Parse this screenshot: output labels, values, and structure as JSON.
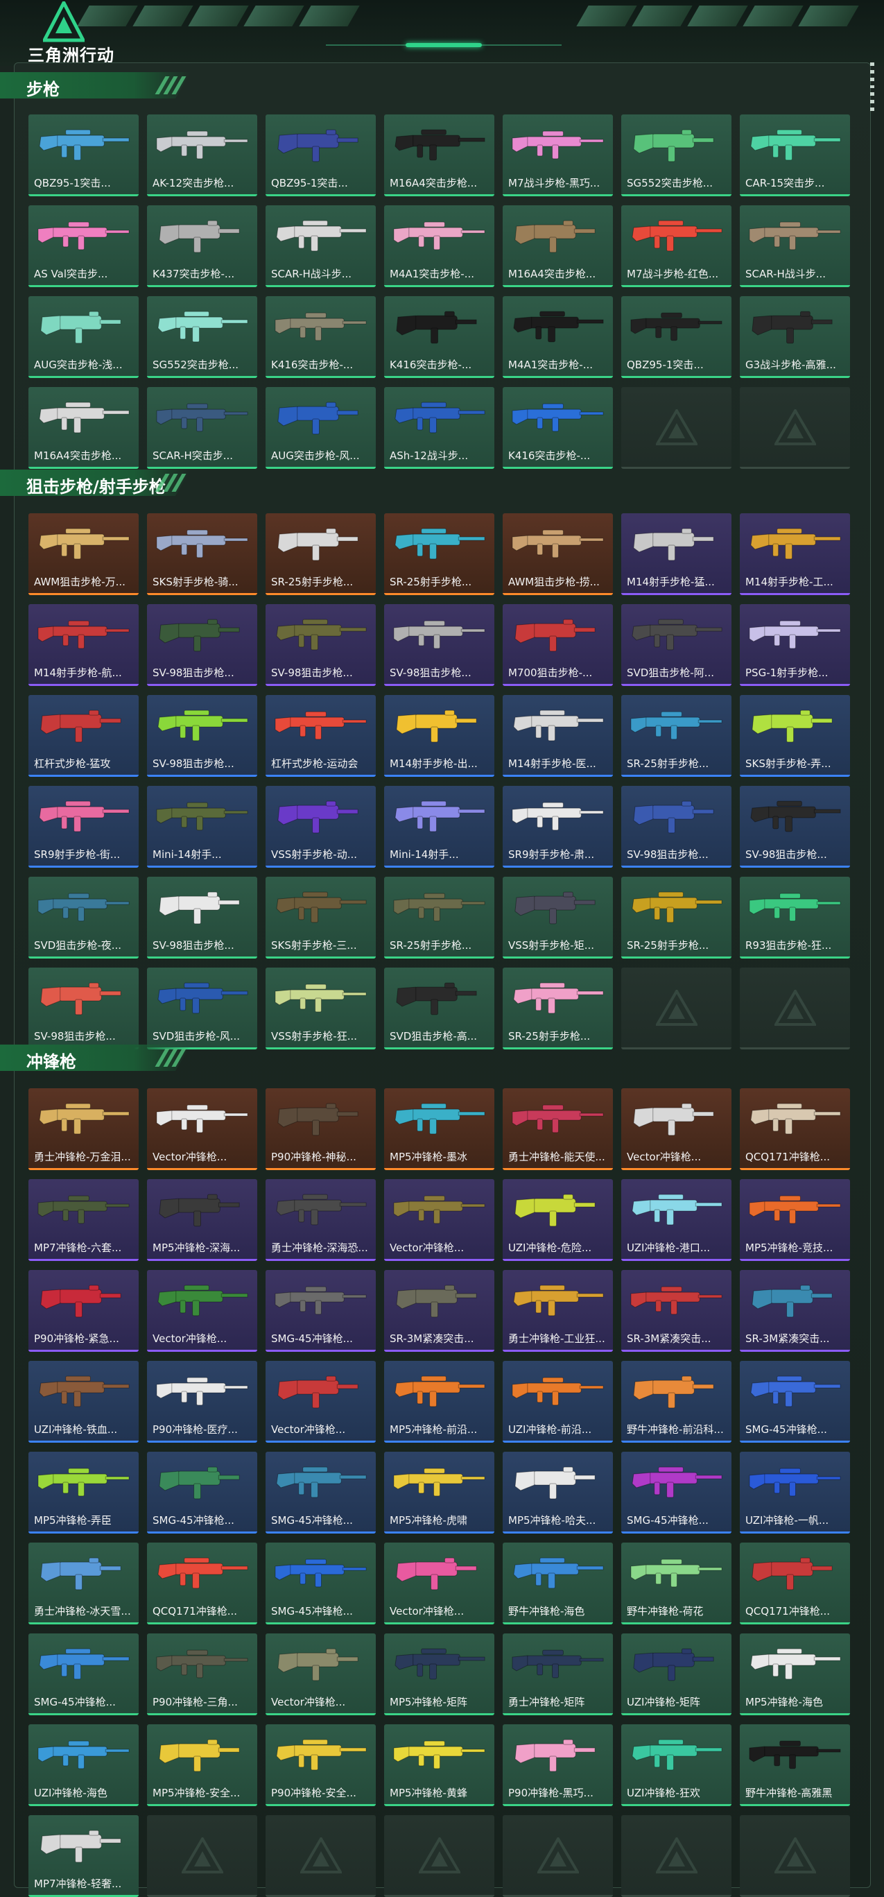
{
  "logo": {
    "text": "三角洲行动",
    "icon": "delta-triangle-logo-icon"
  },
  "colors": {
    "green": "#3ad487",
    "orange": "#ff8a2a",
    "purple": "#8b5cf6",
    "blue": "#3b82f6"
  },
  "sections": [
    {
      "title": "步枪",
      "items": [
        {
          "name": "QBZ95-1突击...",
          "rarity": "green",
          "color": "#4aa3d8"
        },
        {
          "name": "AK-12突击步枪...",
          "rarity": "green",
          "color": "#c9ccd0"
        },
        {
          "name": "QBZ95-1突击...",
          "rarity": "green",
          "color": "#3a4aa0"
        },
        {
          "name": "M16A4突击步枪...",
          "rarity": "green",
          "color": "#222222"
        },
        {
          "name": "M7战斗步枪-黑巧...",
          "rarity": "green",
          "color": "#e88ad0"
        },
        {
          "name": "SG552突击步枪...",
          "rarity": "green",
          "color": "#58c27a"
        },
        {
          "name": "CAR-15突击步...",
          "rarity": "green",
          "color": "#4ed3a3"
        },
        {
          "name": "AS Val突击步...",
          "rarity": "green",
          "color": "#ef7fc0"
        },
        {
          "name": "K437突击步枪-...",
          "rarity": "green",
          "color": "#b0b0b0"
        },
        {
          "name": "SCAR-H战斗步...",
          "rarity": "green",
          "color": "#d8d8d8"
        },
        {
          "name": "M4A1突击步枪-...",
          "rarity": "green",
          "color": "#eaa6c6"
        },
        {
          "name": "M16A4突击步枪...",
          "rarity": "green",
          "color": "#9a7e58"
        },
        {
          "name": "M7战斗步枪-红色...",
          "rarity": "green",
          "color": "#e84a3a"
        },
        {
          "name": "SCAR-H战斗步...",
          "rarity": "green",
          "color": "#a08a70"
        },
        {
          "name": "AUG突击步枪-浅...",
          "rarity": "green",
          "color": "#7fd8c0"
        },
        {
          "name": "SG552突击步枪...",
          "rarity": "green",
          "color": "#8fe0d0"
        },
        {
          "name": "K416突击步枪-...",
          "rarity": "green",
          "color": "#8a8670"
        },
        {
          "name": "K416突击步枪-...",
          "rarity": "green",
          "color": "#1c1c1c"
        },
        {
          "name": "M4A1突击步枪-...",
          "rarity": "green",
          "color": "#1c1c1c"
        },
        {
          "name": "QBZ95-1突击...",
          "rarity": "green",
          "color": "#222222"
        },
        {
          "name": "G3战斗步枪-高雅...",
          "rarity": "green",
          "color": "#2a2a2a"
        },
        {
          "name": "M16A4突击步枪...",
          "rarity": "green",
          "color": "#d8d8d8"
        },
        {
          "name": "SCAR-H突击步...",
          "rarity": "green",
          "color": "#3a5a80"
        },
        {
          "name": "AUG突击步枪-风...",
          "rarity": "green",
          "color": "#2a5fbf"
        },
        {
          "name": "ASh-12战斗步...",
          "rarity": "green",
          "color": "#2a5fbf"
        },
        {
          "name": "K416突击步枪-...",
          "rarity": "green",
          "color": "#2a6fd8"
        },
        {
          "name": "",
          "rarity": "empty"
        },
        {
          "name": "",
          "rarity": "empty"
        }
      ]
    },
    {
      "title": "狙击步枪/射手步枪",
      "items": [
        {
          "name": "AWM狙击步枪-万...",
          "rarity": "orange",
          "color": "#d9b36a"
        },
        {
          "name": "SKS射手步枪-骑...",
          "rarity": "orange",
          "color": "#9aa8c8"
        },
        {
          "name": "SR-25射手步枪...",
          "rarity": "orange",
          "color": "#d8d8d8"
        },
        {
          "name": "SR-25射手步枪...",
          "rarity": "orange",
          "color": "#3ab0c8"
        },
        {
          "name": "AWM狙击步枪-捞...",
          "rarity": "orange",
          "color": "#c9a070"
        },
        {
          "name": "M14射手步枪-猛...",
          "rarity": "purple",
          "color": "#c8c8c8"
        },
        {
          "name": "M14射手步枪-工...",
          "rarity": "purple",
          "color": "#d8a030"
        },
        {
          "name": "M14射手步枪-航...",
          "rarity": "purple",
          "color": "#c83a3a"
        },
        {
          "name": "SV-98狙击步枪...",
          "rarity": "purple",
          "color": "#3a5a3a"
        },
        {
          "name": "SV-98狙击步枪...",
          "rarity": "purple",
          "color": "#6a6a3a"
        },
        {
          "name": "SV-98狙击步枪...",
          "rarity": "purple",
          "color": "#b0b0b0"
        },
        {
          "name": "M700狙击步枪-...",
          "rarity": "purple",
          "color": "#c83a3a"
        },
        {
          "name": "SVD狙击步枪-阿...",
          "rarity": "purple",
          "color": "#4a4a4a"
        },
        {
          "name": "PSG-1射手步枪...",
          "rarity": "purple",
          "color": "#c8c0e8"
        },
        {
          "name": "杠杆式步枪-猛攻",
          "rarity": "blue",
          "color": "#c83a3a"
        },
        {
          "name": "SV-98狙击步枪...",
          "rarity": "blue",
          "color": "#8ad83a"
        },
        {
          "name": "杠杆式步枪-运动会",
          "rarity": "blue",
          "color": "#e84a3a"
        },
        {
          "name": "M14射手步枪-出...",
          "rarity": "blue",
          "color": "#f0c030"
        },
        {
          "name": "M14射手步枪-医...",
          "rarity": "blue",
          "color": "#d8d8d8"
        },
        {
          "name": "SR-25射手步枪...",
          "rarity": "blue",
          "color": "#3a9ac8"
        },
        {
          "name": "SKS射手步枪-弄...",
          "rarity": "blue",
          "color": "#b0e040"
        },
        {
          "name": "SR9射手步枪-街...",
          "rarity": "blue",
          "color": "#e86aa0"
        },
        {
          "name": "Mini-14射手...",
          "rarity": "blue",
          "color": "#5a6a3a"
        },
        {
          "name": "VSS射手步枪-动...",
          "rarity": "blue",
          "color": "#6a3ac8"
        },
        {
          "name": "Mini-14射手...",
          "rarity": "blue",
          "color": "#8a8ae8"
        },
        {
          "name": "SR9射手步枪-肃...",
          "rarity": "blue",
          "color": "#e8e8e8"
        },
        {
          "name": "SV-98狙击步枪...",
          "rarity": "blue",
          "color": "#3a5ab0"
        },
        {
          "name": "SV-98狙击步枪...",
          "rarity": "blue",
          "color": "#2a2a2a"
        },
        {
          "name": "SVD狙击步枪-夜...",
          "rarity": "green",
          "color": "#3a7a9a"
        },
        {
          "name": "SV-98狙击步枪...",
          "rarity": "green",
          "color": "#e8e8e8"
        },
        {
          "name": "SKS射手步枪-三...",
          "rarity": "green",
          "color": "#6a5a3a"
        },
        {
          "name": "SR-25射手步枪...",
          "rarity": "green",
          "color": "#6a6a4a"
        },
        {
          "name": "VSS射手步枪-矩...",
          "rarity": "green",
          "color": "#4a4a5a"
        },
        {
          "name": "SR-25射手步枪...",
          "rarity": "green",
          "color": "#c8a020"
        },
        {
          "name": "R93狙击步枪-狂...",
          "rarity": "green",
          "color": "#3ac880"
        },
        {
          "name": "SV-98狙击步枪...",
          "rarity": "green",
          "color": "#e05a4a"
        },
        {
          "name": "SVD狙击步枪-风...",
          "rarity": "green",
          "color": "#2a5ab0"
        },
        {
          "name": "VSS射手步枪-狂...",
          "rarity": "green",
          "color": "#c8d890"
        },
        {
          "name": "SVD狙击步枪-高...",
          "rarity": "green",
          "color": "#2a2a2a"
        },
        {
          "name": "SR-25射手步枪...",
          "rarity": "green",
          "color": "#f0a0c8"
        },
        {
          "name": "",
          "rarity": "empty"
        },
        {
          "name": "",
          "rarity": "empty"
        }
      ]
    },
    {
      "title": "冲锋枪",
      "items": [
        {
          "name": "勇士冲锋枪-万金泪...",
          "rarity": "orange",
          "color": "#d8b060"
        },
        {
          "name": "Vector冲锋枪...",
          "rarity": "orange",
          "color": "#e8e8e8"
        },
        {
          "name": "P90冲锋枪-神秘...",
          "rarity": "orange",
          "color": "#5a4a3a"
        },
        {
          "name": "MP5冲锋枪-墨冰",
          "rarity": "orange",
          "color": "#3ab0c8"
        },
        {
          "name": "勇士冲锋枪-能天使...",
          "rarity": "orange",
          "color": "#c83a5a"
        },
        {
          "name": "Vector冲锋枪...",
          "rarity": "orange",
          "color": "#d8d8d8"
        },
        {
          "name": "QCQ171冲锋枪...",
          "rarity": "orange",
          "color": "#d8c8b0"
        },
        {
          "name": "MP7冲锋枪-六套...",
          "rarity": "purple",
          "color": "#4a5a3a"
        },
        {
          "name": "MP5冲锋枪-深海...",
          "rarity": "purple",
          "color": "#3a3a3a"
        },
        {
          "name": "勇士冲锋枪-深海恐...",
          "rarity": "purple",
          "color": "#4a4a4a"
        },
        {
          "name": "Vector冲锋枪...",
          "rarity": "purple",
          "color": "#8a7a3a"
        },
        {
          "name": "UZI冲锋枪-危险...",
          "rarity": "purple",
          "color": "#c8d83a"
        },
        {
          "name": "UZI冲锋枪-港口...",
          "rarity": "purple",
          "color": "#8ad8e8"
        },
        {
          "name": "MP5冲锋枪-竞技...",
          "rarity": "purple",
          "color": "#e86a2a"
        },
        {
          "name": "P90冲锋枪-紧急...",
          "rarity": "purple",
          "color": "#c82a3a"
        },
        {
          "name": "Vector冲锋枪...",
          "rarity": "purple",
          "color": "#3a8a3a"
        },
        {
          "name": "SMG-45冲锋枪...",
          "rarity": "purple",
          "color": "#6a6a6a"
        },
        {
          "name": "SR-3M紧凑突击...",
          "rarity": "purple",
          "color": "#6a6a5a"
        },
        {
          "name": "勇士冲锋枪-工业狂...",
          "rarity": "purple",
          "color": "#d8a030"
        },
        {
          "name": "SR-3M紧凑突击...",
          "rarity": "purple",
          "color": "#c83a3a"
        },
        {
          "name": "SR-3M紧凑突击...",
          "rarity": "purple",
          "color": "#3a8ab0"
        },
        {
          "name": "UZI冲锋枪-铁血...",
          "rarity": "blue",
          "color": "#8a5a3a"
        },
        {
          "name": "P90冲锋枪-医疗...",
          "rarity": "blue",
          "color": "#e8e8e8"
        },
        {
          "name": "Vector冲锋枪...",
          "rarity": "blue",
          "color": "#c83a3a"
        },
        {
          "name": "MP5冲锋枪-前沿...",
          "rarity": "blue",
          "color": "#e87a2a"
        },
        {
          "name": "UZI冲锋枪-前沿...",
          "rarity": "blue",
          "color": "#e87a2a"
        },
        {
          "name": "野牛冲锋枪-前沿科...",
          "rarity": "blue",
          "color": "#e88a3a"
        },
        {
          "name": "SMG-45冲锋枪...",
          "rarity": "blue",
          "color": "#3a6ad8"
        },
        {
          "name": "MP5冲锋枪-弄臣",
          "rarity": "blue",
          "color": "#9ad83a"
        },
        {
          "name": "SMG-45冲锋枪...",
          "rarity": "blue",
          "color": "#3a8a5a"
        },
        {
          "name": "SMG-45冲锋枪...",
          "rarity": "blue",
          "color": "#3a8ab0"
        },
        {
          "name": "MP5冲锋枪-虎啸",
          "rarity": "blue",
          "color": "#e8c83a"
        },
        {
          "name": "MP5冲锋枪-哈夫...",
          "rarity": "blue",
          "color": "#e8e8e8"
        },
        {
          "name": "SMG-45冲锋枪...",
          "rarity": "blue",
          "color": "#b03ac8"
        },
        {
          "name": "UZI冲锋枪-一帆...",
          "rarity": "blue",
          "color": "#2a5ad8"
        },
        {
          "name": "勇士冲锋枪-冰天雪...",
          "rarity": "green",
          "color": "#5a9ad8"
        },
        {
          "name": "QCQ171冲锋枪...",
          "rarity": "green",
          "color": "#e84a3a"
        },
        {
          "name": "SMG-45冲锋枪...",
          "rarity": "green",
          "color": "#2a6ad8"
        },
        {
          "name": "Vector冲锋枪...",
          "rarity": "green",
          "color": "#e85aa0"
        },
        {
          "name": "野牛冲锋枪-海色",
          "rarity": "green",
          "color": "#3a8ad8"
        },
        {
          "name": "野牛冲锋枪-荷花",
          "rarity": "green",
          "color": "#8ad88a"
        },
        {
          "name": "QCQ171冲锋枪...",
          "rarity": "green",
          "color": "#c83a3a"
        },
        {
          "name": "SMG-45冲锋枪...",
          "rarity": "green",
          "color": "#3a8ad8"
        },
        {
          "name": "P90冲锋枪-三角...",
          "rarity": "green",
          "color": "#5a5a4a"
        },
        {
          "name": "Vector冲锋枪...",
          "rarity": "green",
          "color": "#8a8a6a"
        },
        {
          "name": "MP5冲锋枪-矩阵",
          "rarity": "green",
          "color": "#2a3a5a"
        },
        {
          "name": "勇士冲锋枪-矩阵",
          "rarity": "green",
          "color": "#2a3a5a"
        },
        {
          "name": "UZI冲锋枪-矩阵",
          "rarity": "green",
          "color": "#2a3a6a"
        },
        {
          "name": "MP5冲锋枪-海色",
          "rarity": "green",
          "color": "#e8e8e8"
        },
        {
          "name": "UZI冲锋枪-海色",
          "rarity": "green",
          "color": "#3a9ad8"
        },
        {
          "name": "MP5冲锋枪-安全...",
          "rarity": "green",
          "color": "#e8c83a"
        },
        {
          "name": "P90冲锋枪-安全...",
          "rarity": "green",
          "color": "#e8c83a"
        },
        {
          "name": "MP5冲锋枪-黄蜂",
          "rarity": "green",
          "color": "#e8d83a"
        },
        {
          "name": "P90冲锋枪-黑巧...",
          "rarity": "green",
          "color": "#f0a0c8"
        },
        {
          "name": "UZI冲锋枪-狂欢",
          "rarity": "green",
          "color": "#3ac8a0"
        },
        {
          "name": "野牛冲锋枪-高雅黑",
          "rarity": "green",
          "color": "#1c1c1c"
        },
        {
          "name": "MP7冲锋枪-轻奢...",
          "rarity": "green",
          "color": "#d8d8d8"
        },
        {
          "name": "",
          "rarity": "empty"
        },
        {
          "name": "",
          "rarity": "empty"
        },
        {
          "name": "",
          "rarity": "empty"
        },
        {
          "name": "",
          "rarity": "empty"
        },
        {
          "name": "",
          "rarity": "empty"
        },
        {
          "name": "",
          "rarity": "empty"
        }
      ]
    }
  ]
}
